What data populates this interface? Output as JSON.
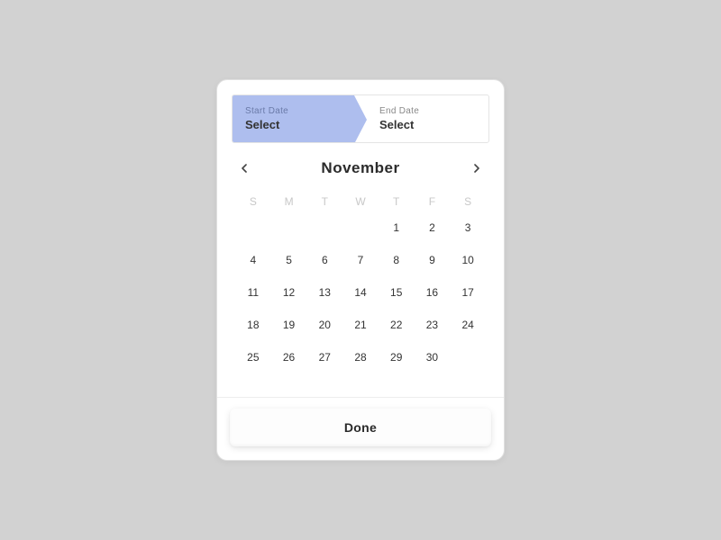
{
  "range": {
    "start": {
      "label": "Start Date",
      "value": "Select"
    },
    "end": {
      "label": "End Date",
      "value": "Select"
    }
  },
  "calendar": {
    "month": "November",
    "weekdays": [
      "S",
      "M",
      "T",
      "W",
      "T",
      "F",
      "S"
    ],
    "leading_blanks": 4,
    "days_in_month": 30
  },
  "actions": {
    "done": "Done"
  }
}
